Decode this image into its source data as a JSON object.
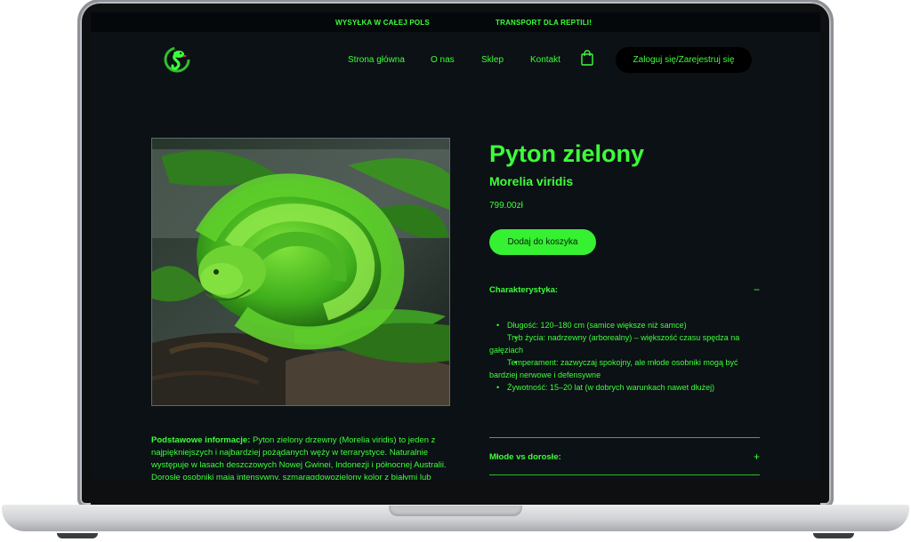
{
  "topbar": {
    "shipping": "WYSYŁKA W CAŁEJ POLS",
    "transport": "TRANSPORT DLA REPTILI!"
  },
  "nav": {
    "home": "Strona główna",
    "about": "O nas",
    "shop": "Sklep",
    "contact": "Kontakt",
    "login": "Zaloguj się/Zarejestruj się"
  },
  "product": {
    "name": "Pyton zielony",
    "latin": "Morelia viridis",
    "price": "799.00zł",
    "add_to_cart": "Dodaj do koszyka"
  },
  "accordion": [
    {
      "title": "Charakterystyka:",
      "sign": "−",
      "items": [
        "Długość: 120–180 cm (samice większe niż samce)",
        "Tryb życia: nadrzewny (arborealny) – większość czasu spędza na gałęziach",
        "Temperament: zazwyczaj spokojny, ale młode osobniki mogą być bardziej nerwowe i defensywne",
        "Żywotność: 15–20 lat (w dobrych warunkach nawet dłużej)"
      ]
    },
    {
      "title": "Młode vs dorosłe:",
      "sign": "+"
    }
  ],
  "info": {
    "label": "Podstawowe informacje:",
    "text": " Pyton zielony drzewny (Morelia viridis) to jeden z najpiękniejszych i najbardziej pożądanych węży w terrarystyce. Naturalnie występuje w lasach deszczowych Nowej Gwinei, Indonezji i północnej Australii. Dorosłe osobniki mają intensywny, szmaragdowozielony kolor z białymi lub"
  },
  "colors": {
    "accent": "#3dff39",
    "background": "#0b1114",
    "button": "#36f032"
  }
}
